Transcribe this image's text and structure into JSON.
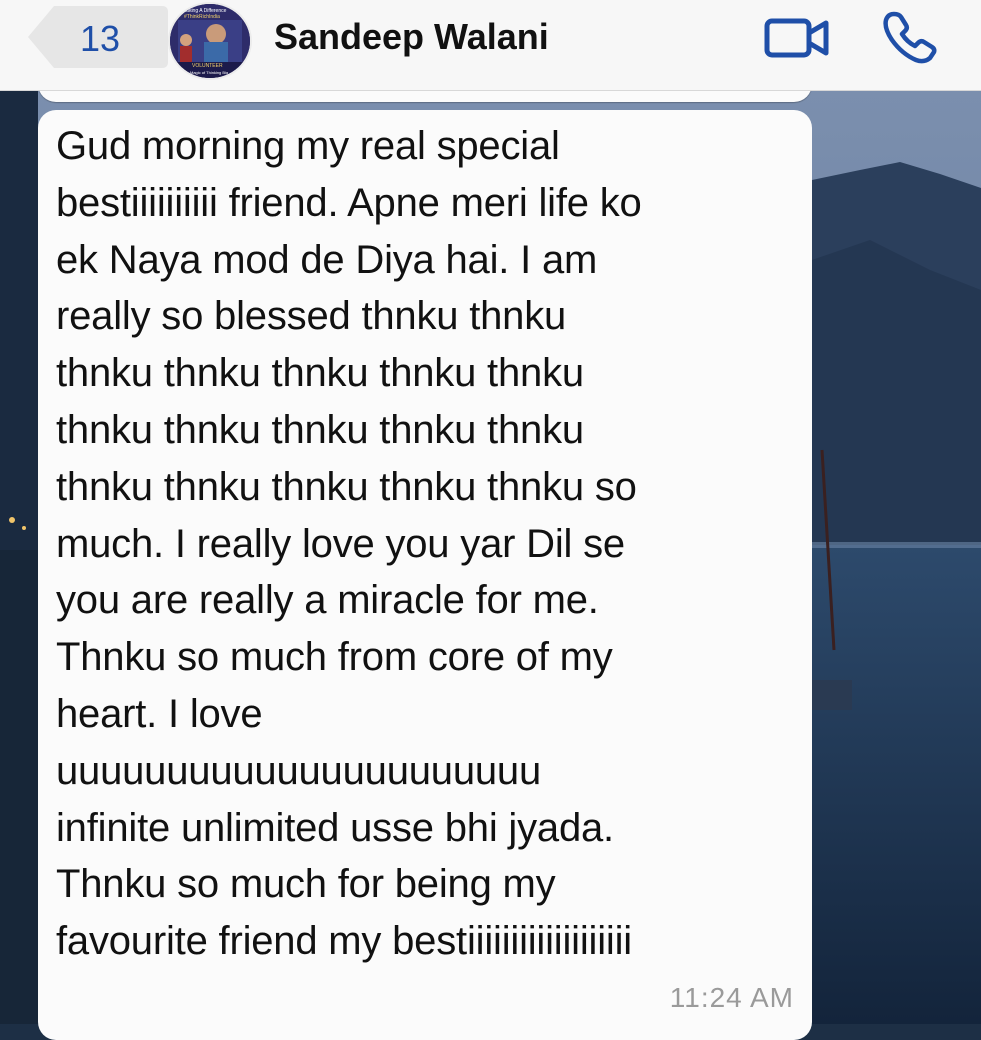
{
  "header": {
    "back_count": "13",
    "contact_name": "Sandeep Walani",
    "back_icon": "chevron-left-icon",
    "video_icon": "video-camera-icon",
    "call_icon": "phone-icon",
    "accent_color": "#1f4fa8"
  },
  "avatar": {
    "line1": "Making A Difference",
    "line2": "#ThinkRichIndia",
    "line3": "VOLUNTEER",
    "line4": "The Magic of Thinking Big"
  },
  "message": {
    "text": "Gud morning my real special\nbestiiiiiiiiii friend. Apne meri life ko\nek Naya mod de Diya hai. I am\nreally so blessed thnku thnku\nthnku thnku thnku thnku thnku\nthnku thnku thnku thnku thnku\nthnku thnku thnku thnku thnku so\nmuch. I really love you yar Dil se\nyou are really a miracle for me.\nThnku so much from core of my\nheart. I love\nuuuuuuuuuuuuuuuuuuuuuu\ninfinite unlimited usse bhi jyada.\nThnku so much for being my\nfavourite friend my bestiiiiiiiiiiiiiiiiiii",
    "time": "11:24 AM"
  }
}
